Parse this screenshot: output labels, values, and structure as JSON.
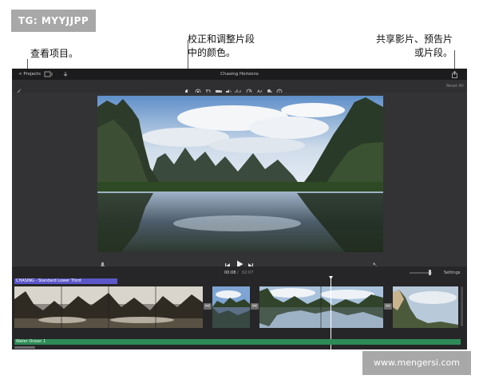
{
  "watermark_top": "TG: MYYJJPP",
  "watermark_bottom": "www.mengersi.com",
  "callouts": {
    "projects": "查看项目。",
    "color_line1": "校正和调整片段",
    "color_line2": "中的颜色。",
    "share_line1": "共享影片、预告片",
    "share_line2": "或片段。"
  },
  "app": {
    "back_label": "< Projects",
    "title": "Chasing Horizons",
    "reset_all": "Reset All",
    "timecode_current": "00:08",
    "timecode_separator": "/",
    "timecode_total": "02:07",
    "settings_label": "Settings",
    "title_clip_label": "CHASING - Standard Lower Third",
    "audio_clip_label": "Water Ocean 1",
    "toolbar_icons": [
      "color-balance-icon",
      "color-correction-icon",
      "crop-icon",
      "stabilization-icon",
      "volume-icon",
      "equalizer-icon",
      "speed-icon",
      "noise-reduction-icon",
      "clip-filter-icon",
      "info-icon"
    ],
    "colors": {
      "window_bg": "#2a2a2c",
      "title_clip": "#5b57c9",
      "audio_clip": "#2e8b57",
      "playhead": "#ffffff"
    }
  }
}
